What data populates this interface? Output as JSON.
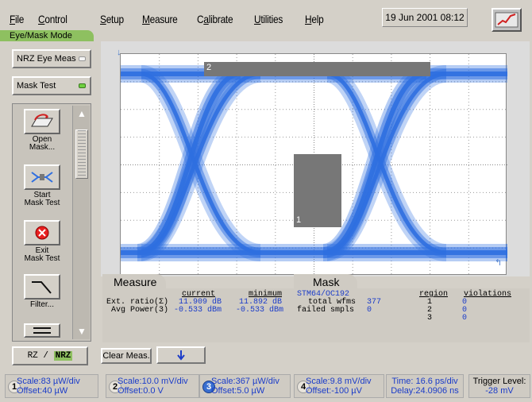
{
  "menu": {
    "items": [
      {
        "label": "File",
        "u": "F",
        "rest": "ile"
      },
      {
        "label": "Control",
        "u": "C",
        "rest": "ontrol"
      },
      {
        "label": "Setup",
        "u": "S",
        "rest": "etup"
      },
      {
        "label": "Measure",
        "u": "M",
        "rest": "easure"
      },
      {
        "label": "Calibrate",
        "u": "a",
        "pre": "C",
        "rest": "librate"
      },
      {
        "label": "Utilities",
        "u": "U",
        "rest": "tilities"
      },
      {
        "label": "Help",
        "u": "H",
        "rest": "elp"
      }
    ],
    "datetime": "19 Jun 2001  08:12",
    "mode": "Eye/Mask Mode"
  },
  "left": {
    "nrz_eye": "NRZ Eye Meas",
    "mask_test": "Mask Test",
    "tools": [
      {
        "label": "Open\nMask...",
        "icon": "open-mask-icon"
      },
      {
        "label": "Start\nMask Test",
        "icon": "start-mask-test-icon"
      },
      {
        "label": "Exit\nMask Test",
        "icon": "exit-mask-test-icon"
      },
      {
        "label": "Filter...",
        "icon": "filter-icon"
      }
    ]
  },
  "graticule": {
    "region_1": "1",
    "region_2": "2",
    "trace_color": "#2f6fe0"
  },
  "measure": {
    "tab": "Measure",
    "col_current": "current",
    "col_minimum": "minimum",
    "rows": [
      {
        "label": "Ext. ratio(Σ)",
        "current": "11.909 dB",
        "minimum": "11.892 dB"
      },
      {
        "label": "Avg Power(3)",
        "current": "-0.533 dBm",
        "minimum": "-0.533 dBm"
      }
    ]
  },
  "mask": {
    "tab": "Mask",
    "name": "STM64/OC192",
    "total_wfms_label": "total wfms",
    "total_wfms": "377",
    "failed_label": "failed smpls",
    "failed": "0",
    "col_region": "region",
    "col_violations": "violations",
    "regions": [
      {
        "region": "1",
        "violations": "0"
      },
      {
        "region": "2",
        "violations": "0"
      },
      {
        "region": "3",
        "violations": "0"
      }
    ]
  },
  "controls": {
    "rz_nrz_prefix": "RZ / ",
    "rz_nrz_active": "NRZ",
    "clear_meas": "Clear Meas."
  },
  "channels": [
    {
      "num": "1",
      "scale": "Scale:83 µW/div",
      "offset": "Offset:40 µW",
      "active": false
    },
    {
      "num": "2",
      "scale": "Scale:10.0 mV/div",
      "offset": "Offset:0.0 V",
      "active": false
    },
    {
      "num": "3",
      "scale": "Scale:367 µW/div",
      "offset": "Offset:5.0 µW",
      "active": true
    },
    {
      "num": "4",
      "scale": "Scale:9.8 mV/div",
      "offset": "Offset:-100 µV",
      "active": false
    }
  ],
  "timebase": {
    "time": "Time: 16.6 ps/div",
    "delay": "Delay:24.0906 ns"
  },
  "trigger": {
    "label": "Trigger Level:",
    "value": "-28 mV"
  }
}
